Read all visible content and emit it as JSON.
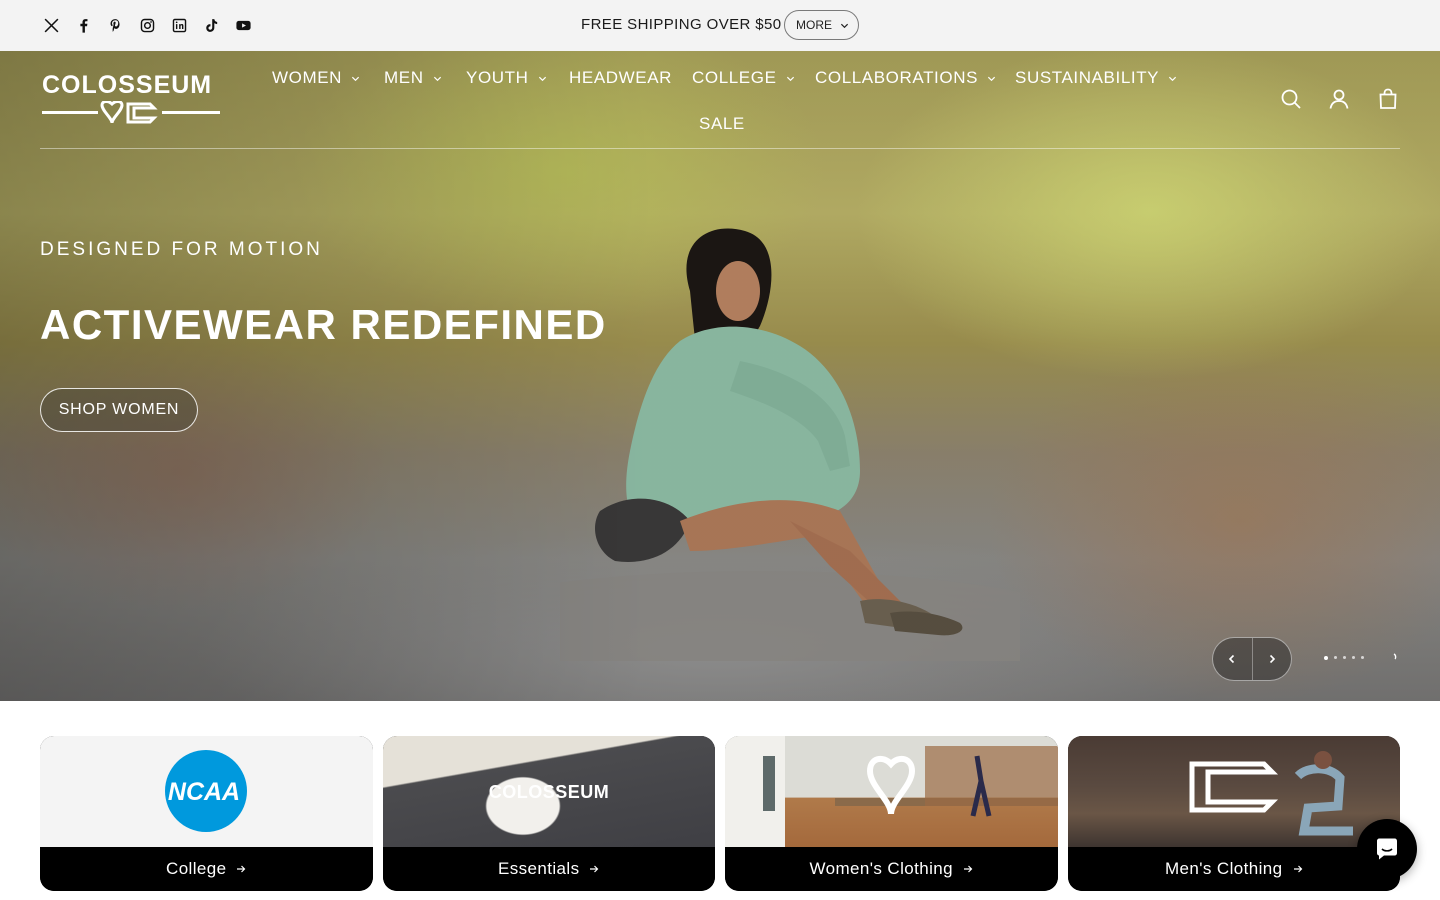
{
  "announcement": {
    "text": "FREE SHIPPING OVER $50",
    "more_label": "MORE",
    "background": "#f3f3f3"
  },
  "socials": [
    {
      "name": "x-icon"
    },
    {
      "name": "facebook-icon"
    },
    {
      "name": "pinterest-icon"
    },
    {
      "name": "instagram-icon"
    },
    {
      "name": "linkedin-icon"
    },
    {
      "name": "tiktok-icon"
    },
    {
      "name": "youtube-icon"
    }
  ],
  "header": {
    "logo_text": "COLOSSEUM",
    "nav": [
      {
        "label": "WOMEN",
        "has_dropdown": true
      },
      {
        "label": "MEN",
        "has_dropdown": true
      },
      {
        "label": "YOUTH",
        "has_dropdown": true
      },
      {
        "label": "HEADWEAR",
        "has_dropdown": false
      },
      {
        "label": "COLLEGE",
        "has_dropdown": true
      },
      {
        "label": "COLLABORATIONS",
        "has_dropdown": true
      },
      {
        "label": "SUSTAINABILITY",
        "has_dropdown": true
      },
      {
        "label": "SALE",
        "has_dropdown": false
      }
    ],
    "icons": [
      "search-icon",
      "account-icon",
      "cart-icon"
    ]
  },
  "hero": {
    "eyebrow": "DESIGNED FOR MOTION",
    "headline": "ACTIVEWEAR REDEFINED",
    "cta_label": "SHOP WOMEN",
    "slide_count": 5,
    "active_slide": 1
  },
  "categories": [
    {
      "label": "College",
      "image_text": "NCAA"
    },
    {
      "label": "Essentials",
      "image_text": "COLOSSEUM"
    },
    {
      "label": "Women's Clothing",
      "image_text": ""
    },
    {
      "label": "Men's Clothing",
      "image_text": ""
    }
  ],
  "colors": {
    "accent": "#000000",
    "text_on_hero": "#ffffff",
    "ncaa_blue": "#0099dd"
  }
}
